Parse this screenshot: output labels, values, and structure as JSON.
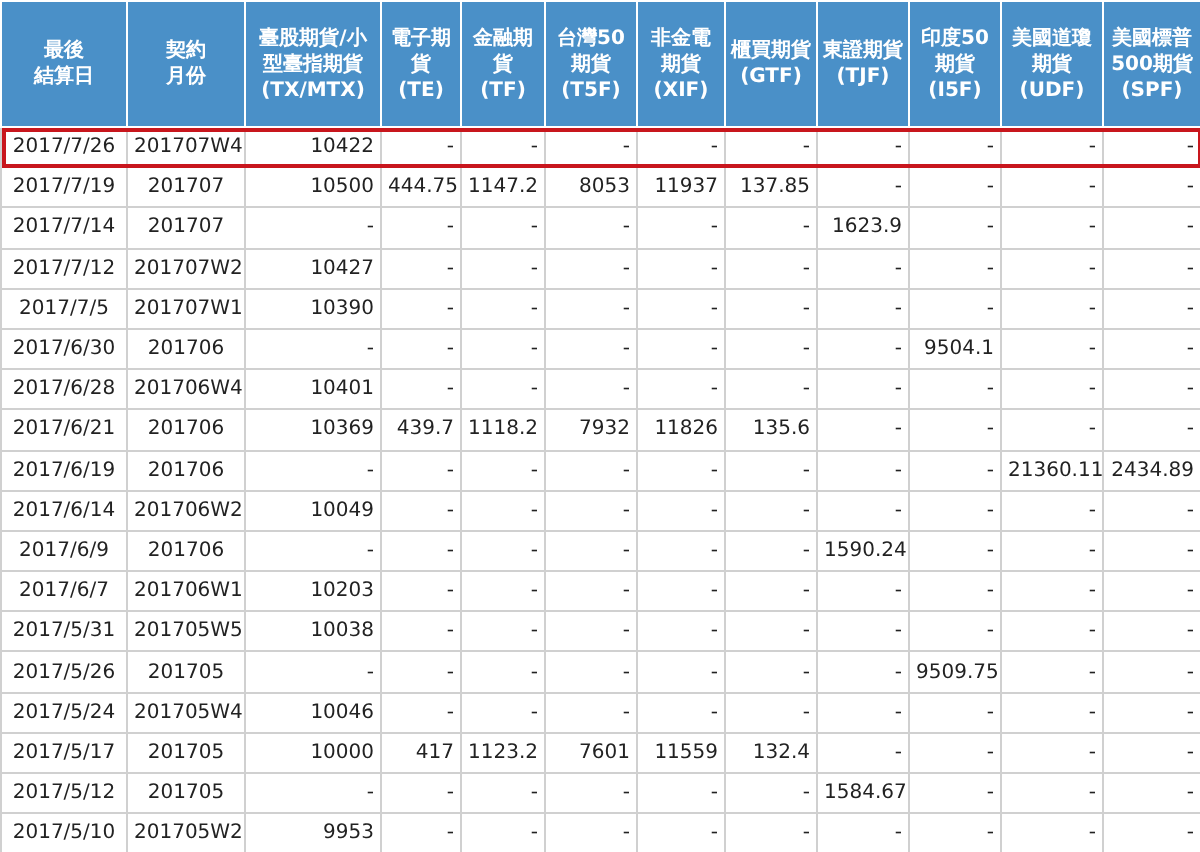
{
  "table": {
    "columns": [
      {
        "lines": [
          "最後",
          "結算日"
        ]
      },
      {
        "lines": [
          "契約",
          "月份"
        ]
      },
      {
        "lines": [
          "臺股期貨/小",
          "型臺指期貨",
          "(TX/MTX)"
        ]
      },
      {
        "lines": [
          "電子期",
          "貨",
          "(TE)"
        ]
      },
      {
        "lines": [
          "金融期",
          "貨",
          "(TF)"
        ]
      },
      {
        "lines": [
          "台灣50",
          "期貨",
          "(T5F)"
        ]
      },
      {
        "lines": [
          "非金電",
          "期貨",
          "(XIF)"
        ]
      },
      {
        "lines": [
          "櫃買期貨",
          "(GTF)"
        ]
      },
      {
        "lines": [
          "東證期貨",
          "(TJF)"
        ]
      },
      {
        "lines": [
          "印度50",
          "期貨",
          "(I5F)"
        ]
      },
      {
        "lines": [
          "美國道瓊",
          "期貨",
          "(UDF)"
        ]
      },
      {
        "lines": [
          "美國標普",
          "500期貨",
          "(SPF)"
        ]
      }
    ],
    "rows": [
      {
        "highlighted": true,
        "cells": [
          "2017/7/26",
          "201707W4",
          "10422",
          "-",
          "-",
          "-",
          "-",
          "-",
          "-",
          "-",
          "-",
          "-"
        ]
      },
      {
        "highlighted": false,
        "cells": [
          "2017/7/19",
          "201707",
          "10500",
          "444.75",
          "1147.2",
          "8053",
          "11937",
          "137.85",
          "-",
          "-",
          "-",
          "-"
        ]
      },
      {
        "highlighted": false,
        "cells": [
          "2017/7/14",
          "201707",
          "-",
          "-",
          "-",
          "-",
          "-",
          "-",
          "1623.9",
          "-",
          "-",
          "-"
        ]
      },
      {
        "highlighted": false,
        "cells": [
          "2017/7/12",
          "201707W2",
          "10427",
          "-",
          "-",
          "-",
          "-",
          "-",
          "-",
          "-",
          "-",
          "-"
        ]
      },
      {
        "highlighted": false,
        "cells": [
          "2017/7/5",
          "201707W1",
          "10390",
          "-",
          "-",
          "-",
          "-",
          "-",
          "-",
          "-",
          "-",
          "-"
        ]
      },
      {
        "highlighted": false,
        "cells": [
          "2017/6/30",
          "201706",
          "-",
          "-",
          "-",
          "-",
          "-",
          "-",
          "-",
          "9504.1",
          "-",
          "-"
        ]
      },
      {
        "highlighted": false,
        "cells": [
          "2017/6/28",
          "201706W4",
          "10401",
          "-",
          "-",
          "-",
          "-",
          "-",
          "-",
          "-",
          "-",
          "-"
        ]
      },
      {
        "highlighted": false,
        "cells": [
          "2017/6/21",
          "201706",
          "10369",
          "439.7",
          "1118.2",
          "7932",
          "11826",
          "135.6",
          "-",
          "-",
          "-",
          "-"
        ]
      },
      {
        "highlighted": false,
        "cells": [
          "2017/6/19",
          "201706",
          "-",
          "-",
          "-",
          "-",
          "-",
          "-",
          "-",
          "-",
          "21360.11",
          "2434.89"
        ]
      },
      {
        "highlighted": false,
        "cells": [
          "2017/6/14",
          "201706W2",
          "10049",
          "-",
          "-",
          "-",
          "-",
          "-",
          "-",
          "-",
          "-",
          "-"
        ]
      },
      {
        "highlighted": false,
        "cells": [
          "2017/6/9",
          "201706",
          "-",
          "-",
          "-",
          "-",
          "-",
          "-",
          "1590.24",
          "-",
          "-",
          "-"
        ]
      },
      {
        "highlighted": false,
        "cells": [
          "2017/6/7",
          "201706W1",
          "10203",
          "-",
          "-",
          "-",
          "-",
          "-",
          "-",
          "-",
          "-",
          "-"
        ]
      },
      {
        "highlighted": false,
        "cells": [
          "2017/5/31",
          "201705W5",
          "10038",
          "-",
          "-",
          "-",
          "-",
          "-",
          "-",
          "-",
          "-",
          "-"
        ]
      },
      {
        "highlighted": false,
        "cells": [
          "2017/5/26",
          "201705",
          "-",
          "-",
          "-",
          "-",
          "-",
          "-",
          "-",
          "9509.75",
          "-",
          "-"
        ]
      },
      {
        "highlighted": false,
        "cells": [
          "2017/5/24",
          "201705W4",
          "10046",
          "-",
          "-",
          "-",
          "-",
          "-",
          "-",
          "-",
          "-",
          "-"
        ]
      },
      {
        "highlighted": false,
        "cells": [
          "2017/5/17",
          "201705",
          "10000",
          "417",
          "1123.2",
          "7601",
          "11559",
          "132.4",
          "-",
          "-",
          "-",
          "-"
        ]
      },
      {
        "highlighted": false,
        "cells": [
          "2017/5/12",
          "201705",
          "-",
          "-",
          "-",
          "-",
          "-",
          "-",
          "1584.67",
          "-",
          "-",
          "-"
        ]
      },
      {
        "highlighted": false,
        "cells": [
          "2017/5/10",
          "201705W2",
          "9953",
          "-",
          "-",
          "-",
          "-",
          "-",
          "-",
          "-",
          "-",
          "-"
        ]
      }
    ]
  }
}
